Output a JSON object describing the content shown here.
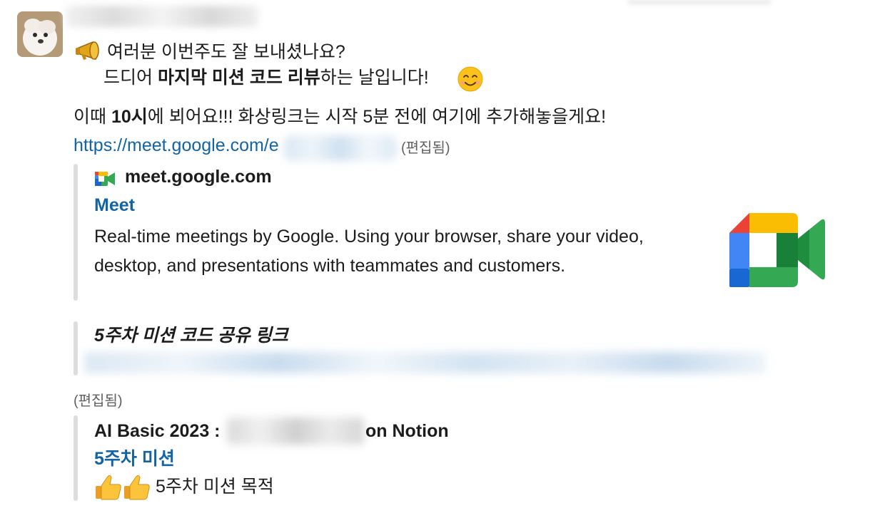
{
  "message": {
    "line1": "여러분 이번주도 잘 보내셨나요?",
    "line2_pre": "드디어 ",
    "line2_bold": "마지막 미션 코드 리뷰",
    "line2_post": "하는 날입니다!",
    "line3_pre": "이때 ",
    "line3_bold": "10시",
    "line3_post": "에 뵈어요!!! 화상링크는 시작 5분 전에 여기에 추가해놓을게요!",
    "link_visible": "https://meet.google.com/e",
    "edited_label": "(편집됨)",
    "edited_label_2": "(편집됨)"
  },
  "unfurl_meet": {
    "site": "meet.google.com",
    "title": "Meet",
    "description": "Real-time meetings by Google. Using your browser, share your video, desktop, and presentations with teammates and customers."
  },
  "quote_notion": {
    "title": "5주차 미션 코드 공유 링크"
  },
  "unfurl_notion": {
    "title_prefix": "AI Basic 2023 :",
    "title_suffix": "on Notion",
    "subtitle": "5주차 미션",
    "snippet": "5주차 미션 목적"
  },
  "icons": {
    "megaphone": "megaphone-emoji",
    "smile": "smiling-face-emoji",
    "meet_logo": "google-meet-icon",
    "thumbs": "thumbs-up-emoji"
  },
  "colors": {
    "link": "#1264a3",
    "text": "#1d1c1d",
    "meet_blue": "#4285f4",
    "meet_green": "#34a853",
    "meet_yellow": "#fbbc04",
    "meet_red": "#ea4335"
  }
}
